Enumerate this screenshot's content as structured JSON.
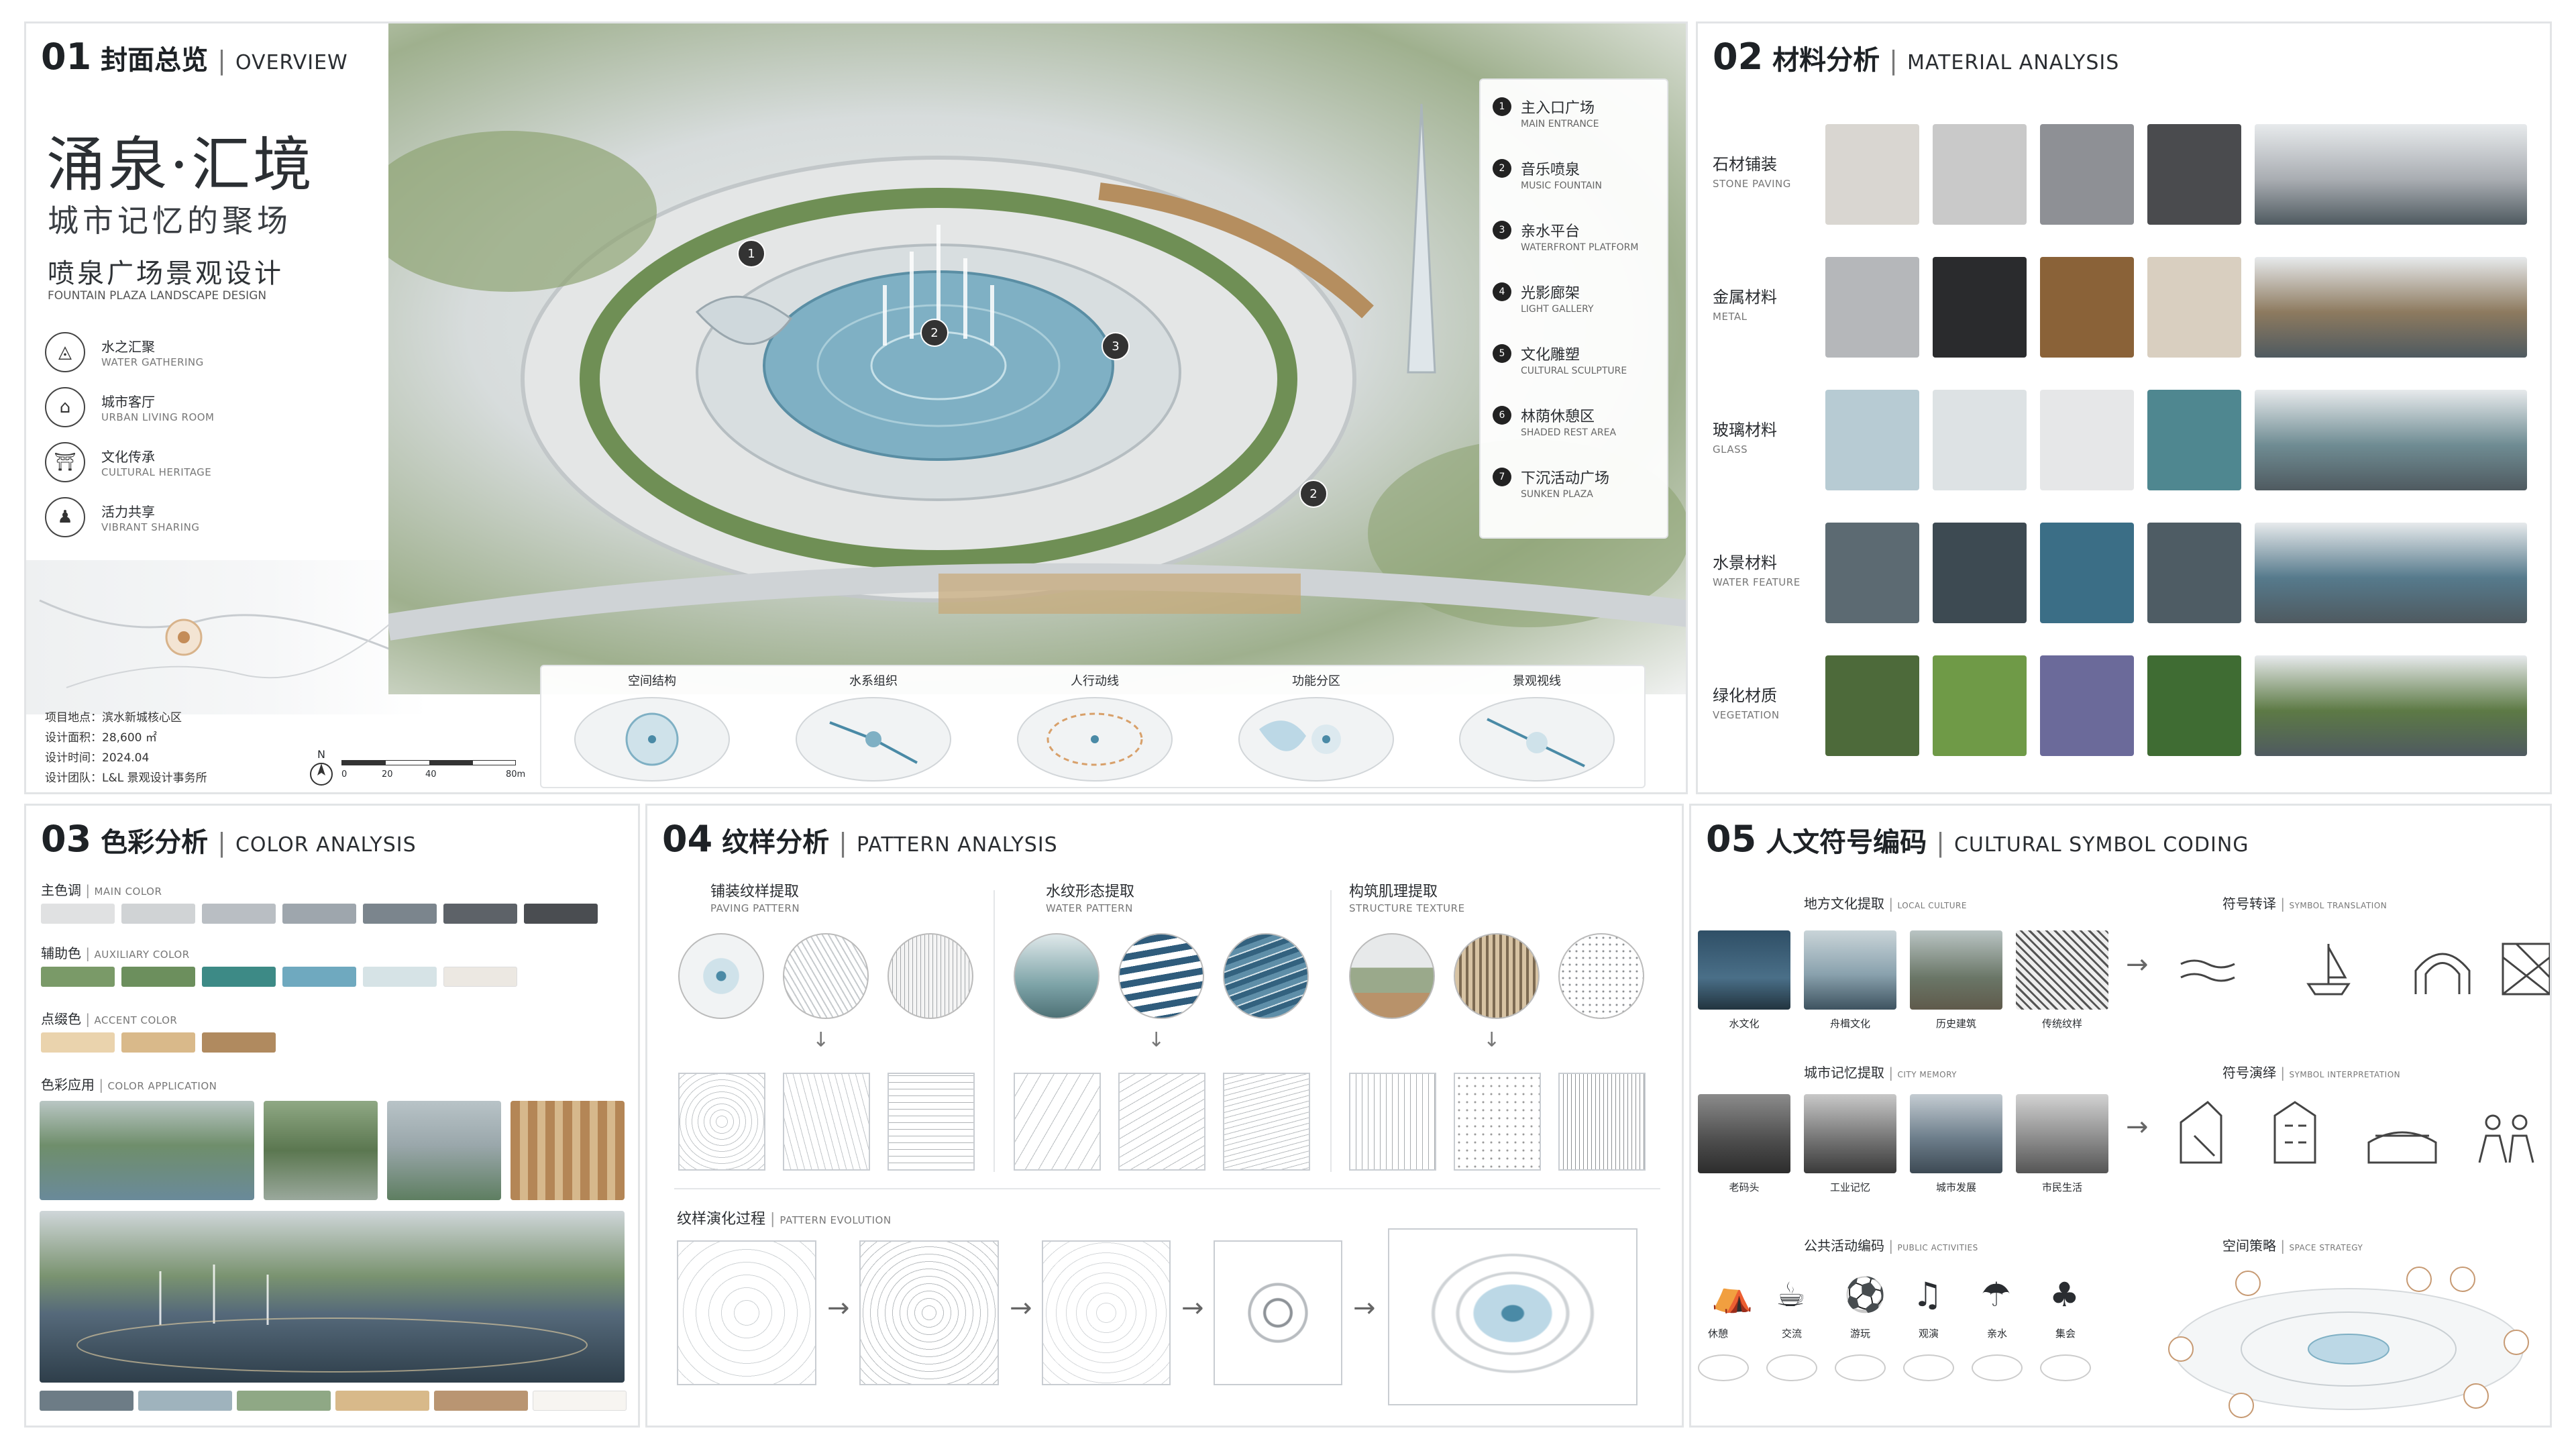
{
  "p1": {
    "num": "01",
    "cn": "封面总览",
    "en": "OVERVIEW",
    "title": "涌泉·汇境",
    "sub": "城市记忆的聚场",
    "design": "喷泉广场景观设计",
    "design_en": "FOUNTAIN PLAZA LANDSCAPE DESIGN",
    "concepts": [
      {
        "cn": "水之汇聚",
        "en": "WATER GATHERING",
        "icon": "water-drop-icon"
      },
      {
        "cn": "城市客厅",
        "en": "URBAN LIVING ROOM",
        "icon": "building-icon"
      },
      {
        "cn": "文化传承",
        "en": "CULTURAL HERITAGE",
        "icon": "pavilion-icon"
      },
      {
        "cn": "活力共享",
        "en": "VIBRANT SHARING",
        "icon": "person-icon"
      }
    ],
    "info": [
      "项目地点：滨水新城核心区",
      "设计面积：28,600 ㎡",
      "设计时间：2024.04",
      "设计团队：L&L 景观设计事务所"
    ],
    "scale": {
      "n": "N",
      "t0": "0",
      "t1": "20",
      "t2": "40",
      "t3": "80m"
    },
    "legend": [
      {
        "n": "1",
        "cn": "主入口广场",
        "en": "MAIN ENTRANCE"
      },
      {
        "n": "2",
        "cn": "音乐喷泉",
        "en": "MUSIC FOUNTAIN"
      },
      {
        "n": "3",
        "cn": "亲水平台",
        "en": "WATERFRONT PLATFORM"
      },
      {
        "n": "4",
        "cn": "光影廊架",
        "en": "LIGHT GALLERY"
      },
      {
        "n": "5",
        "cn": "文化雕塑",
        "en": "CULTURAL SCULPTURE"
      },
      {
        "n": "6",
        "cn": "林荫休憩区",
        "en": "SHADED REST AREA"
      },
      {
        "n": "7",
        "cn": "下沉活动广场",
        "en": "SUNKEN PLAZA"
      }
    ],
    "map_markers": [
      "1",
      "2",
      "3",
      "2"
    ],
    "diagrams": [
      "空间结构",
      "水系组织",
      "人行动线",
      "功能分区",
      "景观视线"
    ]
  },
  "p2": {
    "num": "02",
    "cn": "材料分析",
    "en": "MATERIAL ANALYSIS",
    "rows": [
      {
        "cn": "石材铺装",
        "en": "STONE PAVING",
        "colors": [
          "#d9d6d1",
          "#c9c9c9",
          "#8e9095",
          "#4a4b4e"
        ],
        "photo": "#a9adb2"
      },
      {
        "cn": "金属材料",
        "en": "METAL",
        "colors": [
          "#b5b7ba",
          "#2a2b2d",
          "#8a6238",
          "#d9cfc0"
        ],
        "photo": "#8d7a5f"
      },
      {
        "cn": "玻璃材料",
        "en": "GLASS",
        "colors": [
          "#b7cbd3",
          "#dde2e4",
          "#e6e7e8",
          "#4f8790"
        ],
        "photo": "#6f8c93"
      },
      {
        "cn": "水景材料",
        "en": "WATER FEATURE",
        "colors": [
          "#5c6a72",
          "#3d4a52",
          "#3b6e86",
          "#4e5c64"
        ],
        "photo": "#567a8c"
      },
      {
        "cn": "绿化材质",
        "en": "VEGETATION",
        "colors": [
          "#4d6a3a",
          "#6f9a47",
          "#6b6a9a",
          "#3f6c33"
        ],
        "photo": "#5d7a45"
      }
    ]
  },
  "p3": {
    "num": "03",
    "cn": "色彩分析",
    "en": "COLOR ANALYSIS",
    "main": {
      "cn": "主色调",
      "en": "MAIN COLOR",
      "colors": [
        "#e0e1e2",
        "#d0d3d5",
        "#b9bec3",
        "#9ea6ad",
        "#7b858d",
        "#5d6268",
        "#4a4d51"
      ]
    },
    "aux": {
      "cn": "辅助色",
      "en": "AUXILIARY COLOR",
      "colors": [
        "#7a9a68",
        "#6c8f5d",
        "#3d8a86",
        "#6fa9bf",
        "#d6e3e6",
        "#ece8e2"
      ]
    },
    "accent": {
      "cn": "点缀色",
      "en": "ACCENT COLOR",
      "colors": [
        "#ead3ad",
        "#d9b98a",
        "#b08a5f"
      ]
    },
    "app": {
      "cn": "色彩应用",
      "en": "COLOR APPLICATION"
    },
    "bottom": [
      "#6d7c86",
      "#9fb3bd",
      "#8fa885",
      "#d8b98a",
      "#b99572",
      "#f7f5f1"
    ]
  },
  "p4": {
    "num": "04",
    "cn": "纹样分析",
    "en": "PATTERN ANALYSIS",
    "cols": [
      {
        "cn": "铺装纹样提取",
        "en": "PAVING PATTERN"
      },
      {
        "cn": "水纹形态提取",
        "en": "WATER PATTERN"
      },
      {
        "cn": "构筑肌理提取",
        "en": "STRUCTURE TEXTURE"
      }
    ],
    "evo": {
      "cn": "纹样演化过程",
      "en": "PATTERN EVOLUTION"
    }
  },
  "p5": {
    "num": "05",
    "cn": "人文符号编码",
    "en": "CULTURAL SYMBOL CODING",
    "local": {
      "cn": "地方文化提取",
      "en": "LOCAL CULTURE",
      "items": [
        "水文化",
        "舟楫文化",
        "历史建筑",
        "传统纹样"
      ]
    },
    "trans": {
      "cn": "符号转译",
      "en": "SYMBOL TRANSLATION"
    },
    "memory": {
      "cn": "城市记忆提取",
      "en": "CITY MEMORY",
      "items": [
        "老码头",
        "工业记忆",
        "城市发展",
        "市民生活"
      ]
    },
    "interp": {
      "cn": "符号演绎",
      "en": "SYMBOL INTERPRETATION"
    },
    "public": {
      "cn": "公共活动编码",
      "en": "PUBLIC ACTIVITIES",
      "items": [
        "休憩",
        "交流",
        "游玩",
        "观演",
        "亲水",
        "集会"
      ]
    },
    "space": {
      "cn": "空间策略",
      "en": "SPACE STRATEGY"
    }
  },
  "colors": {
    "accent": "#4a8aa6",
    "water": "#7fb0c4",
    "border": "#e2e4e6"
  }
}
